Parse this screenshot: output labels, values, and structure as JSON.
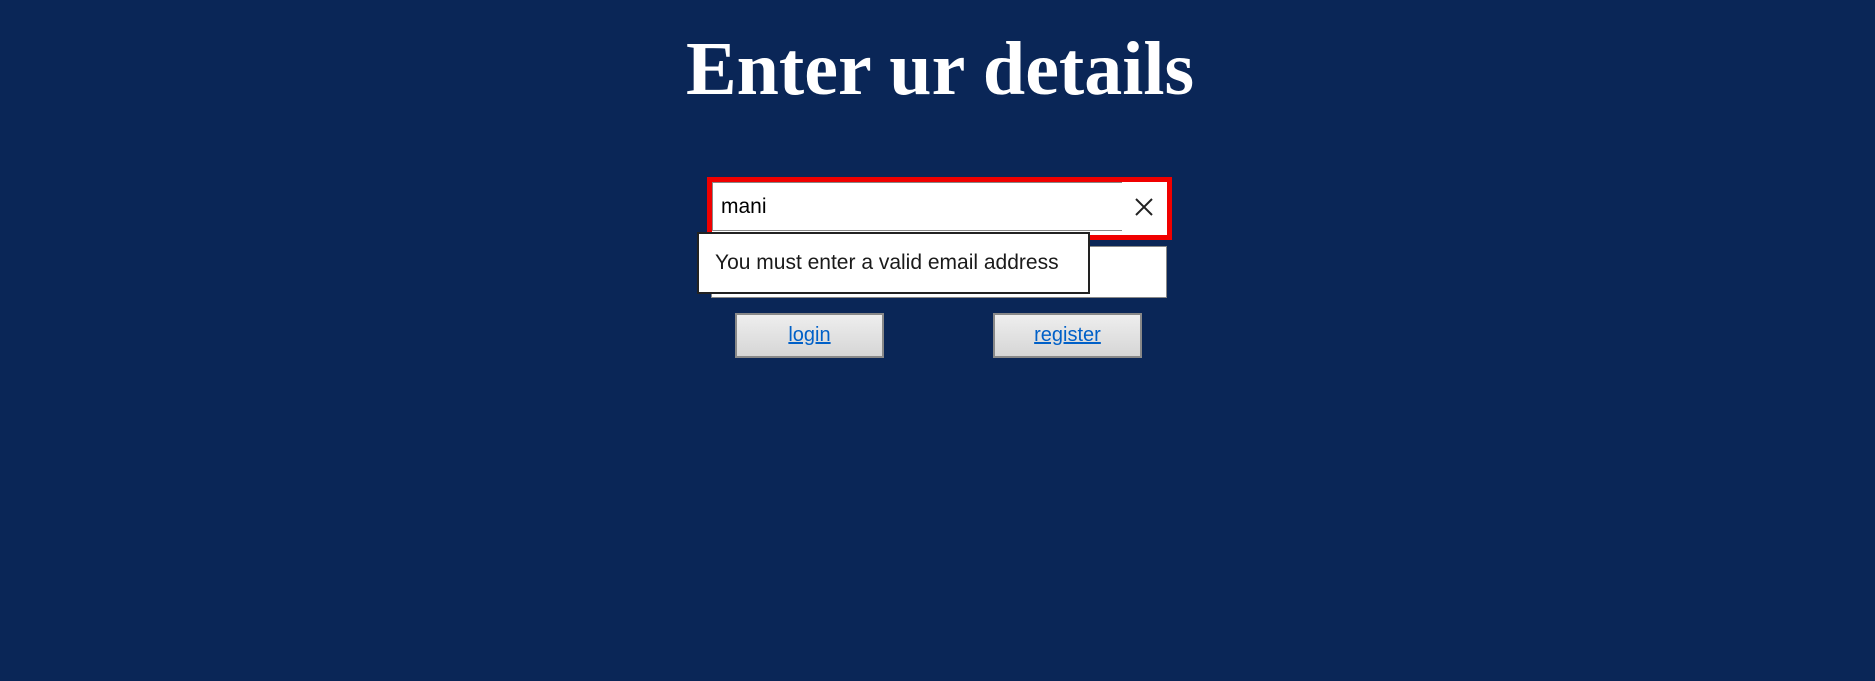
{
  "title": "Enter ur details",
  "email_field": {
    "value": "mani",
    "clear_icon": "close-icon"
  },
  "password_field": {
    "value": ""
  },
  "validation_tooltip": "You must enter a valid email address",
  "buttons": {
    "login": "login",
    "register": "register"
  },
  "colors": {
    "background": "#0a2657",
    "error_outline": "#f00000",
    "link": "#0060c8"
  }
}
